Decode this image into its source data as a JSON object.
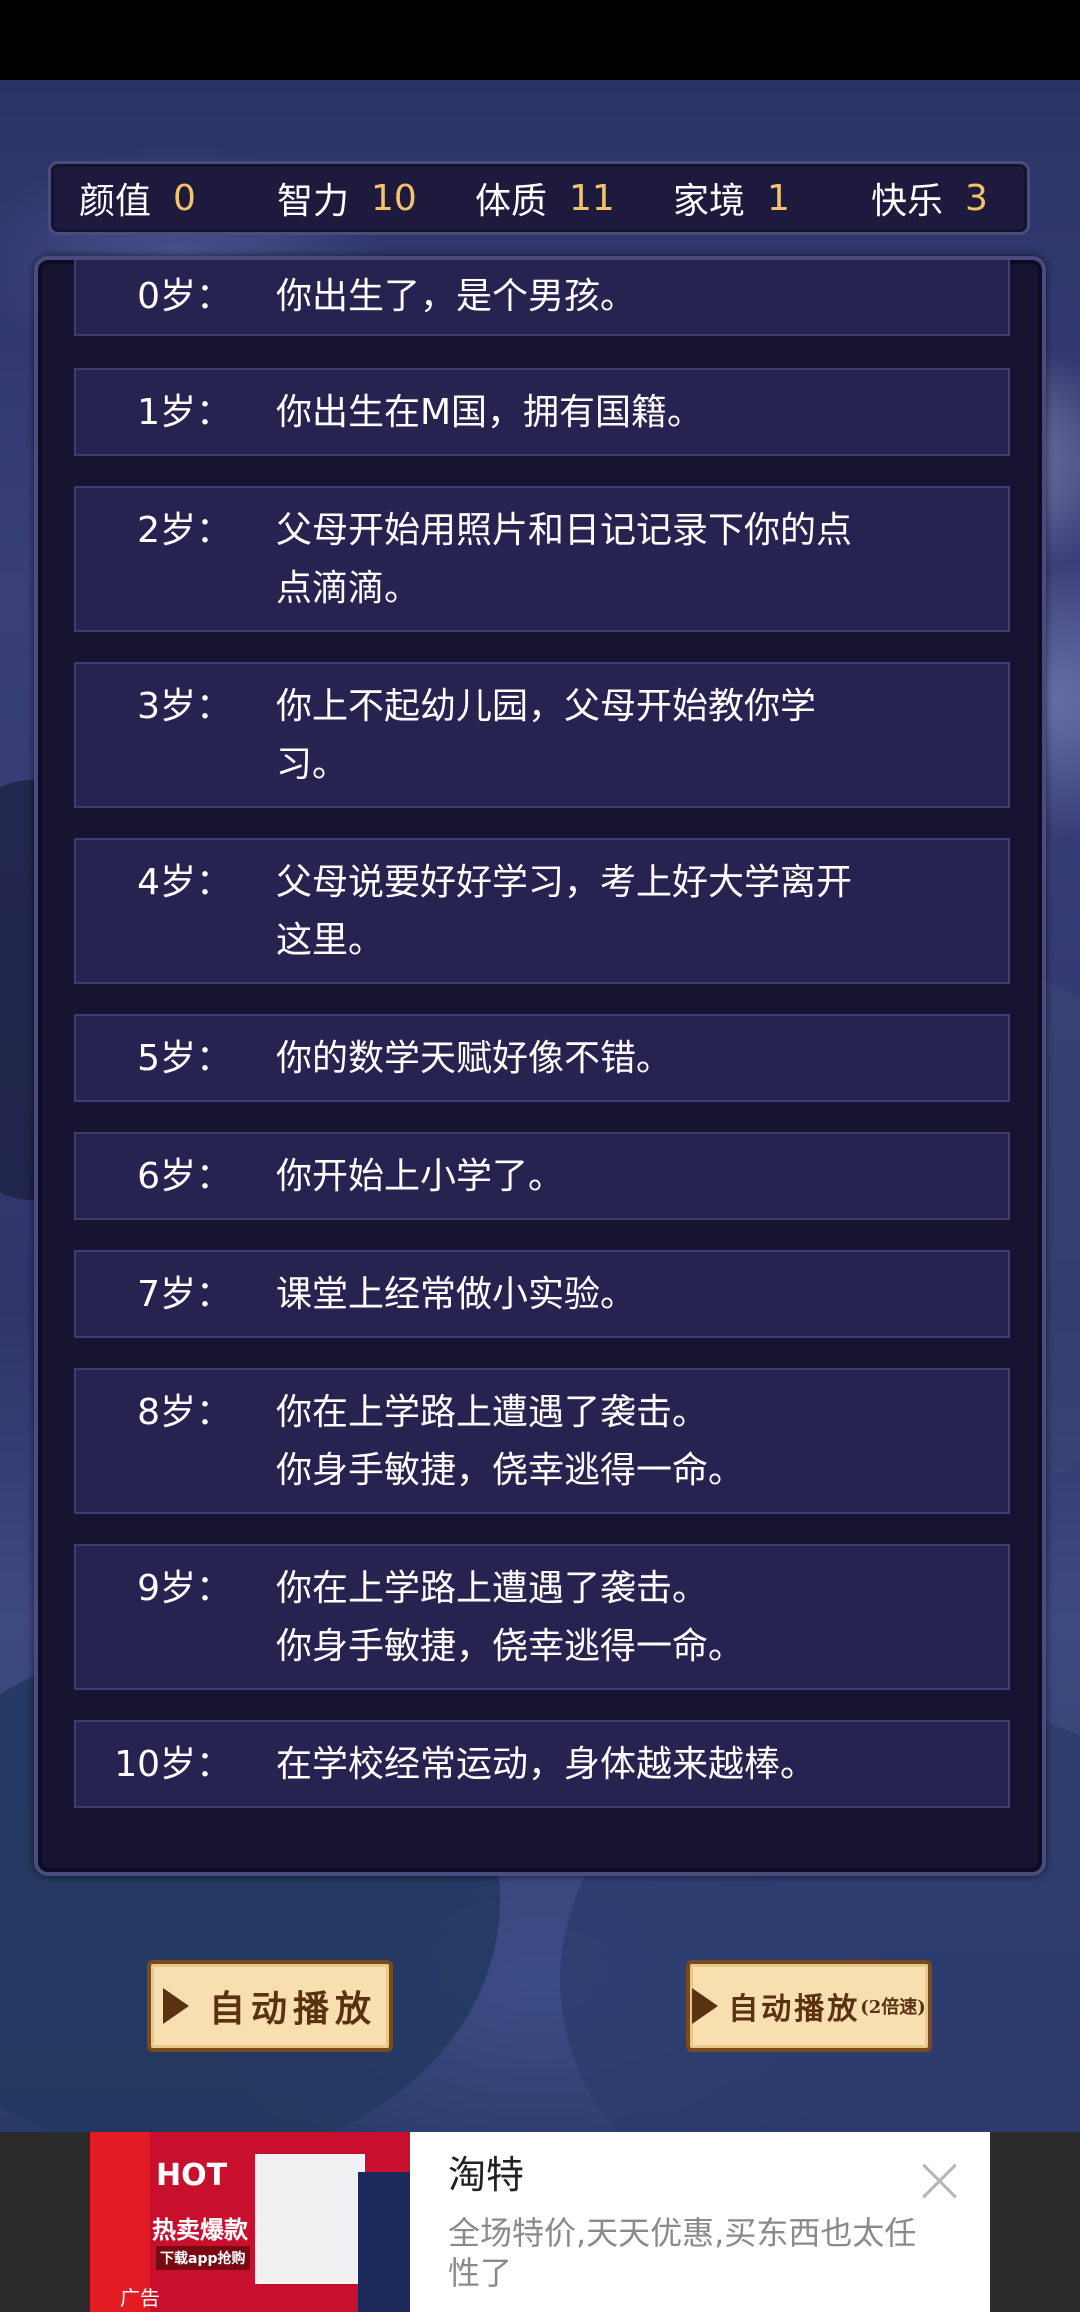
{
  "stats": [
    {
      "label": "颜值",
      "value": "0"
    },
    {
      "label": "智力",
      "value": "10"
    },
    {
      "label": "体质",
      "value": "11"
    },
    {
      "label": "家境",
      "value": "1"
    },
    {
      "label": "快乐",
      "value": "3"
    }
  ],
  "timeline": [
    {
      "age": "0岁：",
      "lines": [
        "你出生了，是个男孩。"
      ]
    },
    {
      "age": "1岁：",
      "lines": [
        "你出生在M国，拥有国籍。"
      ]
    },
    {
      "age": "2岁：",
      "lines": [
        "父母开始用照片和日记记录下你的点",
        "点滴滴。"
      ]
    },
    {
      "age": "3岁：",
      "lines": [
        "你上不起幼儿园，父母开始教你学",
        "习。"
      ]
    },
    {
      "age": "4岁：",
      "lines": [
        "父母说要好好学习，考上好大学离开",
        "这里。"
      ]
    },
    {
      "age": "5岁：",
      "lines": [
        "你的数学天赋好像不错。"
      ]
    },
    {
      "age": "6岁：",
      "lines": [
        "你开始上小学了。"
      ]
    },
    {
      "age": "7岁：",
      "lines": [
        "课堂上经常做小实验。"
      ]
    },
    {
      "age": "8岁：",
      "lines": [
        "你在上学路上遭遇了袭击。",
        "你身手敏捷，侥幸逃得一命。"
      ]
    },
    {
      "age": "9岁：",
      "lines": [
        "你在上学路上遭遇了袭击。",
        "你身手敏捷，侥幸逃得一命。"
      ]
    },
    {
      "age": "10岁：",
      "lines": [
        "在学校经常运动，身体越来越棒。"
      ]
    }
  ],
  "buttons": {
    "autoplay": "自动播放",
    "autoplay2x": "自动播放",
    "autoplay2x_suffix": "(2倍速)"
  },
  "ad": {
    "title": "淘特",
    "description": "全场特价,天天优惠,买东西也太任性了",
    "badge": "广告",
    "image_texts": {
      "hot": "HOT",
      "promo": "热卖爆款",
      "cta": "下载app抢购"
    }
  },
  "colors": {
    "stat_value": "#f2c56a",
    "panel_bg": "#161430",
    "entry_bg": "#272350",
    "button_bg": "#f7dfb0",
    "button_text": "#5a3212"
  }
}
